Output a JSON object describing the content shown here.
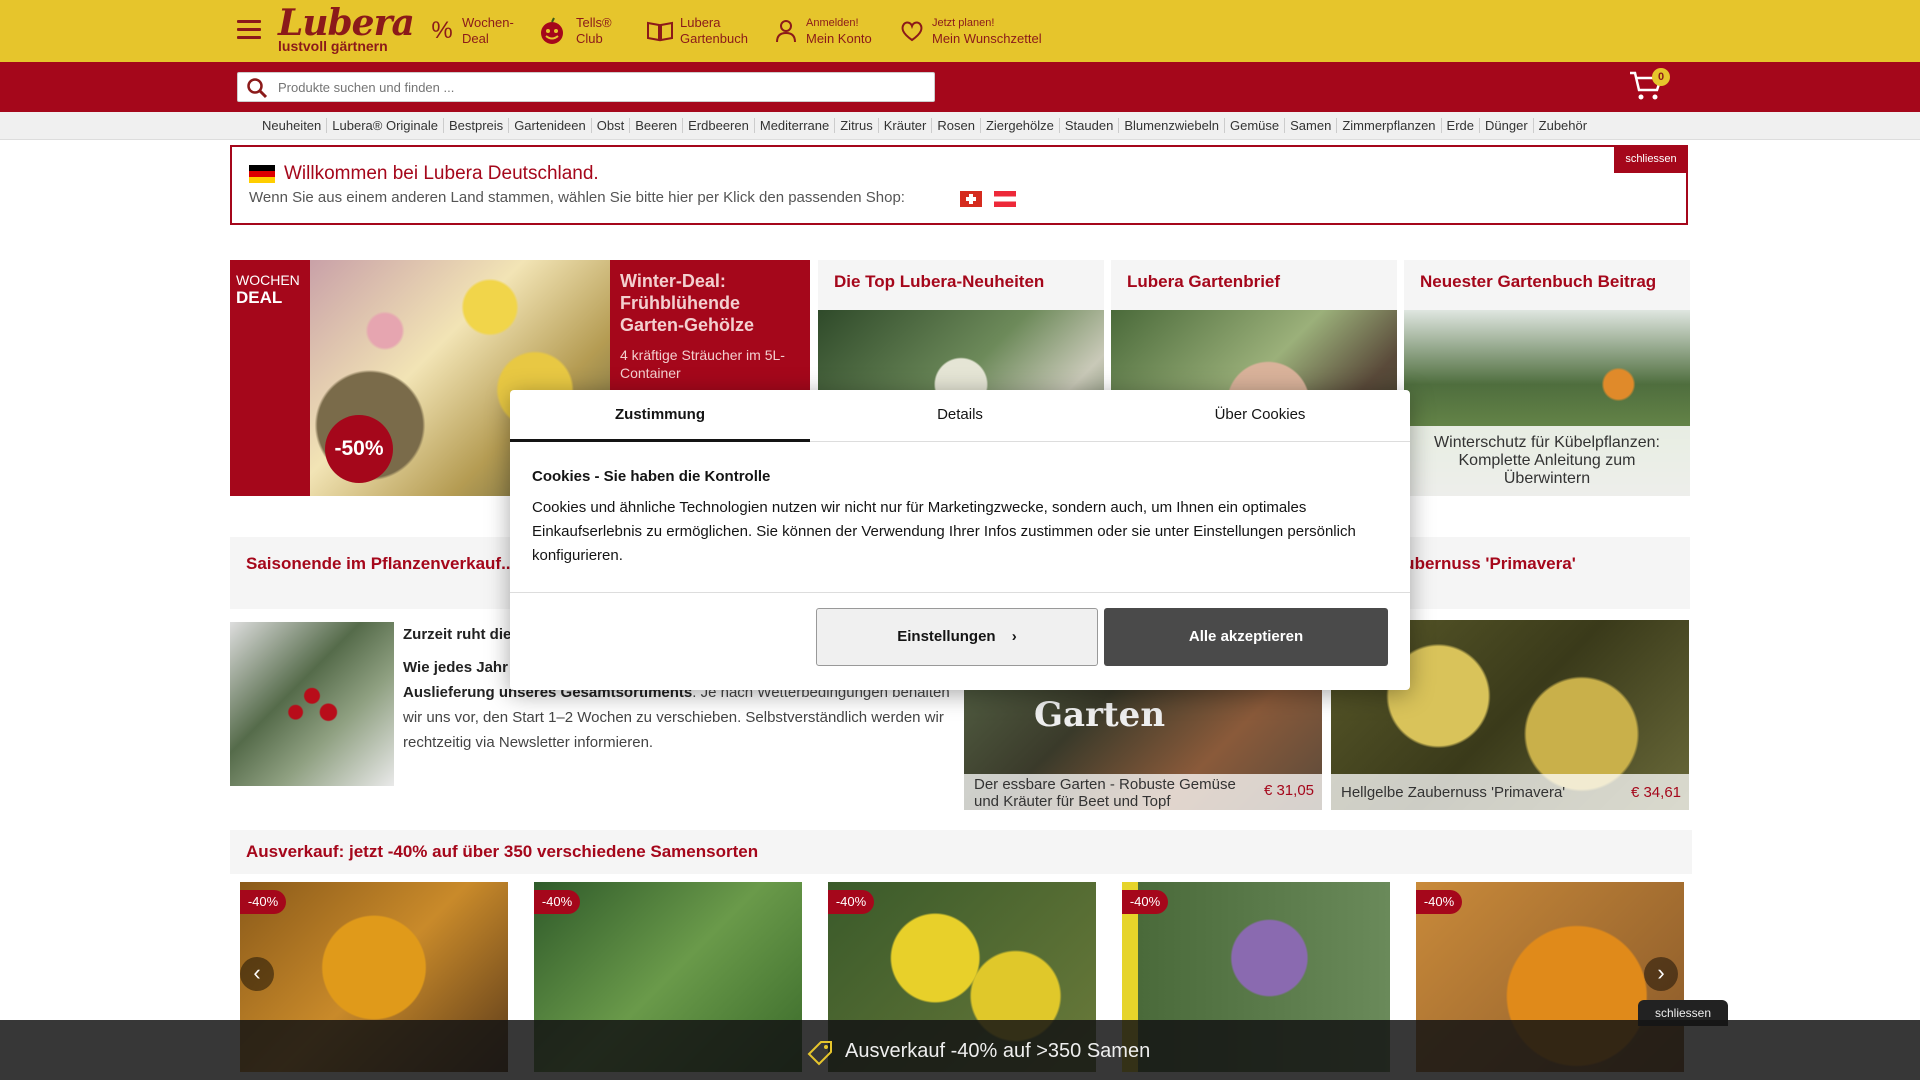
{
  "header": {
    "logo": "Lubera",
    "logo_sub": "lustvoll gärtnern",
    "nav": [
      {
        "line1": "Wochen-",
        "line2": "Deal"
      },
      {
        "line1": "Tells®",
        "line2": "Club"
      },
      {
        "line1": "Lubera",
        "line2": "Gartenbuch"
      },
      {
        "line1": "Anmelden!",
        "line2": "Mein Konto"
      },
      {
        "line1": "Jetzt planen!",
        "line2": "Mein Wunschzettel"
      }
    ]
  },
  "search": {
    "placeholder": "Produkte suchen und finden ..."
  },
  "cart": {
    "count": "0"
  },
  "categories": [
    "Neuheiten",
    "Lubera® Originale",
    "Bestpreis",
    "Gartenideen",
    "Obst",
    "Beeren",
    "Erdbeeren",
    "Mediterrane",
    "Zitrus",
    "Kräuter",
    "Rosen",
    "Ziergehölze",
    "Stauden",
    "Blumenzwiebeln",
    "Gemüse",
    "Samen",
    "Zimmerpflanzen",
    "Erde",
    "Dünger",
    "Zubehör"
  ],
  "welcome": {
    "title": "Willkommen bei Lubera Deutschland.",
    "text": "Wenn Sie aus einem anderen Land stammen, wählen Sie bitte hier per Klick den passenden Shop:",
    "close": "schliessen"
  },
  "deal": {
    "label_top": "WOCHEN",
    "label_bottom": "DEAL",
    "badge": "-50%",
    "title": "Winter-Deal: Frühblühende Garten-Gehölze",
    "text": "4 kräftige Sträucher im 5L-Container"
  },
  "tiles": [
    {
      "title": "Die Top Lubera-Neuheiten"
    },
    {
      "title": "Lubera Gartenbrief"
    },
    {
      "title": "Neuester Gartenbuch Beitrag",
      "caption": "Winterschutz für Kübelpflanzen: Komplette Anleitung zum Überwintern"
    }
  ],
  "section": {
    "title_left": "Saisonende im Pflanzenverkauf...",
    "title_right": "...e Zaubernuss 'Primavera'",
    "body_heading": "Zurzeit ruht die",
    "body_bold": "Wie jedes Jahr",
    "body_bold2": "Auslieferung unseres Gesamtsortiments",
    "body_rest": ". Je nach Wetterbedingungen behalten wir uns vor, den Start 1–2 Wochen zu verschieben. Selbstverständlich werden wir rechtzeitig via Newsletter informieren."
  },
  "products": [
    {
      "name": "Der essbare Garten - Robuste Gemüse und Kräuter für Beet und Topf",
      "price": "€ 31,05",
      "overlay": "Garten"
    },
    {
      "name": "Hellgelbe Zaubernuss 'Primavera'",
      "price": "€ 34,61"
    }
  ],
  "sale": {
    "title": "Ausverkauf: jetzt -40% auf über 350 verschiedene Samensorten",
    "badge": "-40%"
  },
  "bottom": {
    "text": "Ausverkauf -40% auf >350 Samen",
    "close": "schliessen"
  },
  "cookie": {
    "tabs": [
      "Zustimmung",
      "Details",
      "Über Cookies"
    ],
    "title": "Cookies - Sie haben die Kontrolle",
    "text": "Cookies und ähnliche Technologien nutzen wir nicht nur für Marketingzwecke, sondern auch, um Ihnen ein optimales Einkaufserlebnis zu ermöglichen. Sie können der Verwendung Ihrer Infos zustimmen oder sie unter Einstellungen persönlich konfigurieren.",
    "btn_settings": "Einstellungen",
    "btn_accept": "Alle akzeptieren"
  },
  "colors": {
    "brand_yellow": "#e6c52c",
    "brand_red": "#a5071b"
  }
}
